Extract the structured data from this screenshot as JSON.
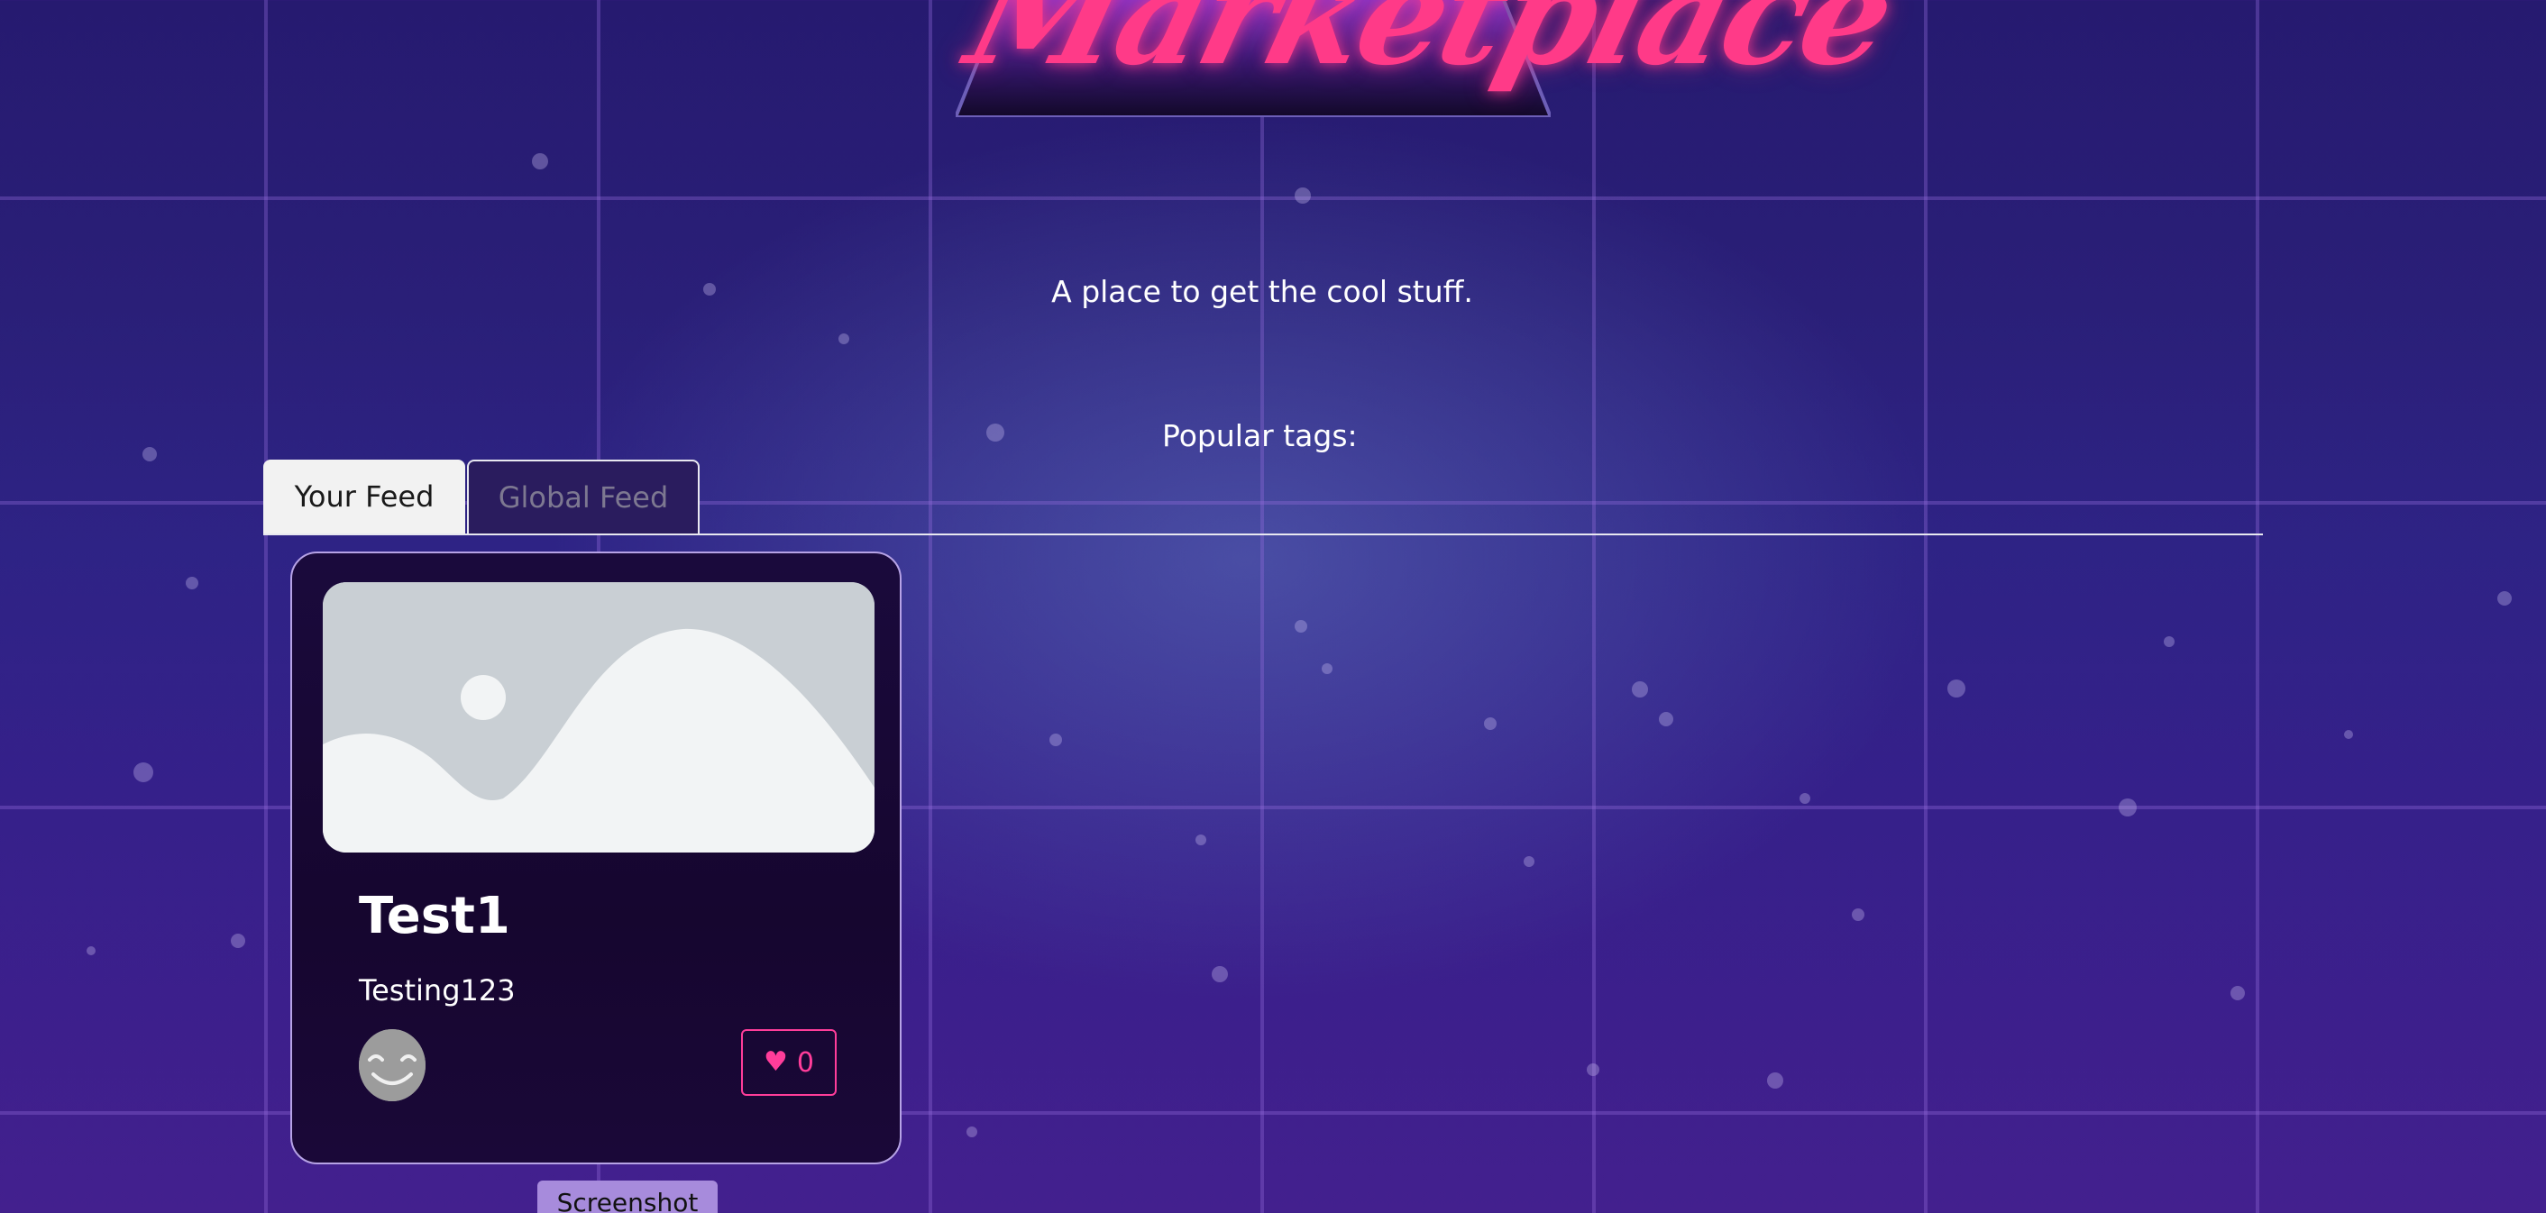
{
  "header": {
    "logo_text": "Marketplace",
    "tagline": "A place to get the cool stuff."
  },
  "tags": {
    "heading": "Popular tags:"
  },
  "tabs": [
    {
      "label": "Your Feed",
      "active": true
    },
    {
      "label": "Global Feed",
      "active": false
    }
  ],
  "card": {
    "title": "Test1",
    "description": "Testing123",
    "likes": "0",
    "image_icon": "image-placeholder-icon",
    "avatar_icon": "smiley-avatar-icon"
  },
  "footer": {
    "screenshot_label": "Screenshot"
  },
  "colors": {
    "accent_pink": "#ff3d9a",
    "card_border": "#b7a3e6",
    "screenshot_button": "#a78bdc"
  }
}
